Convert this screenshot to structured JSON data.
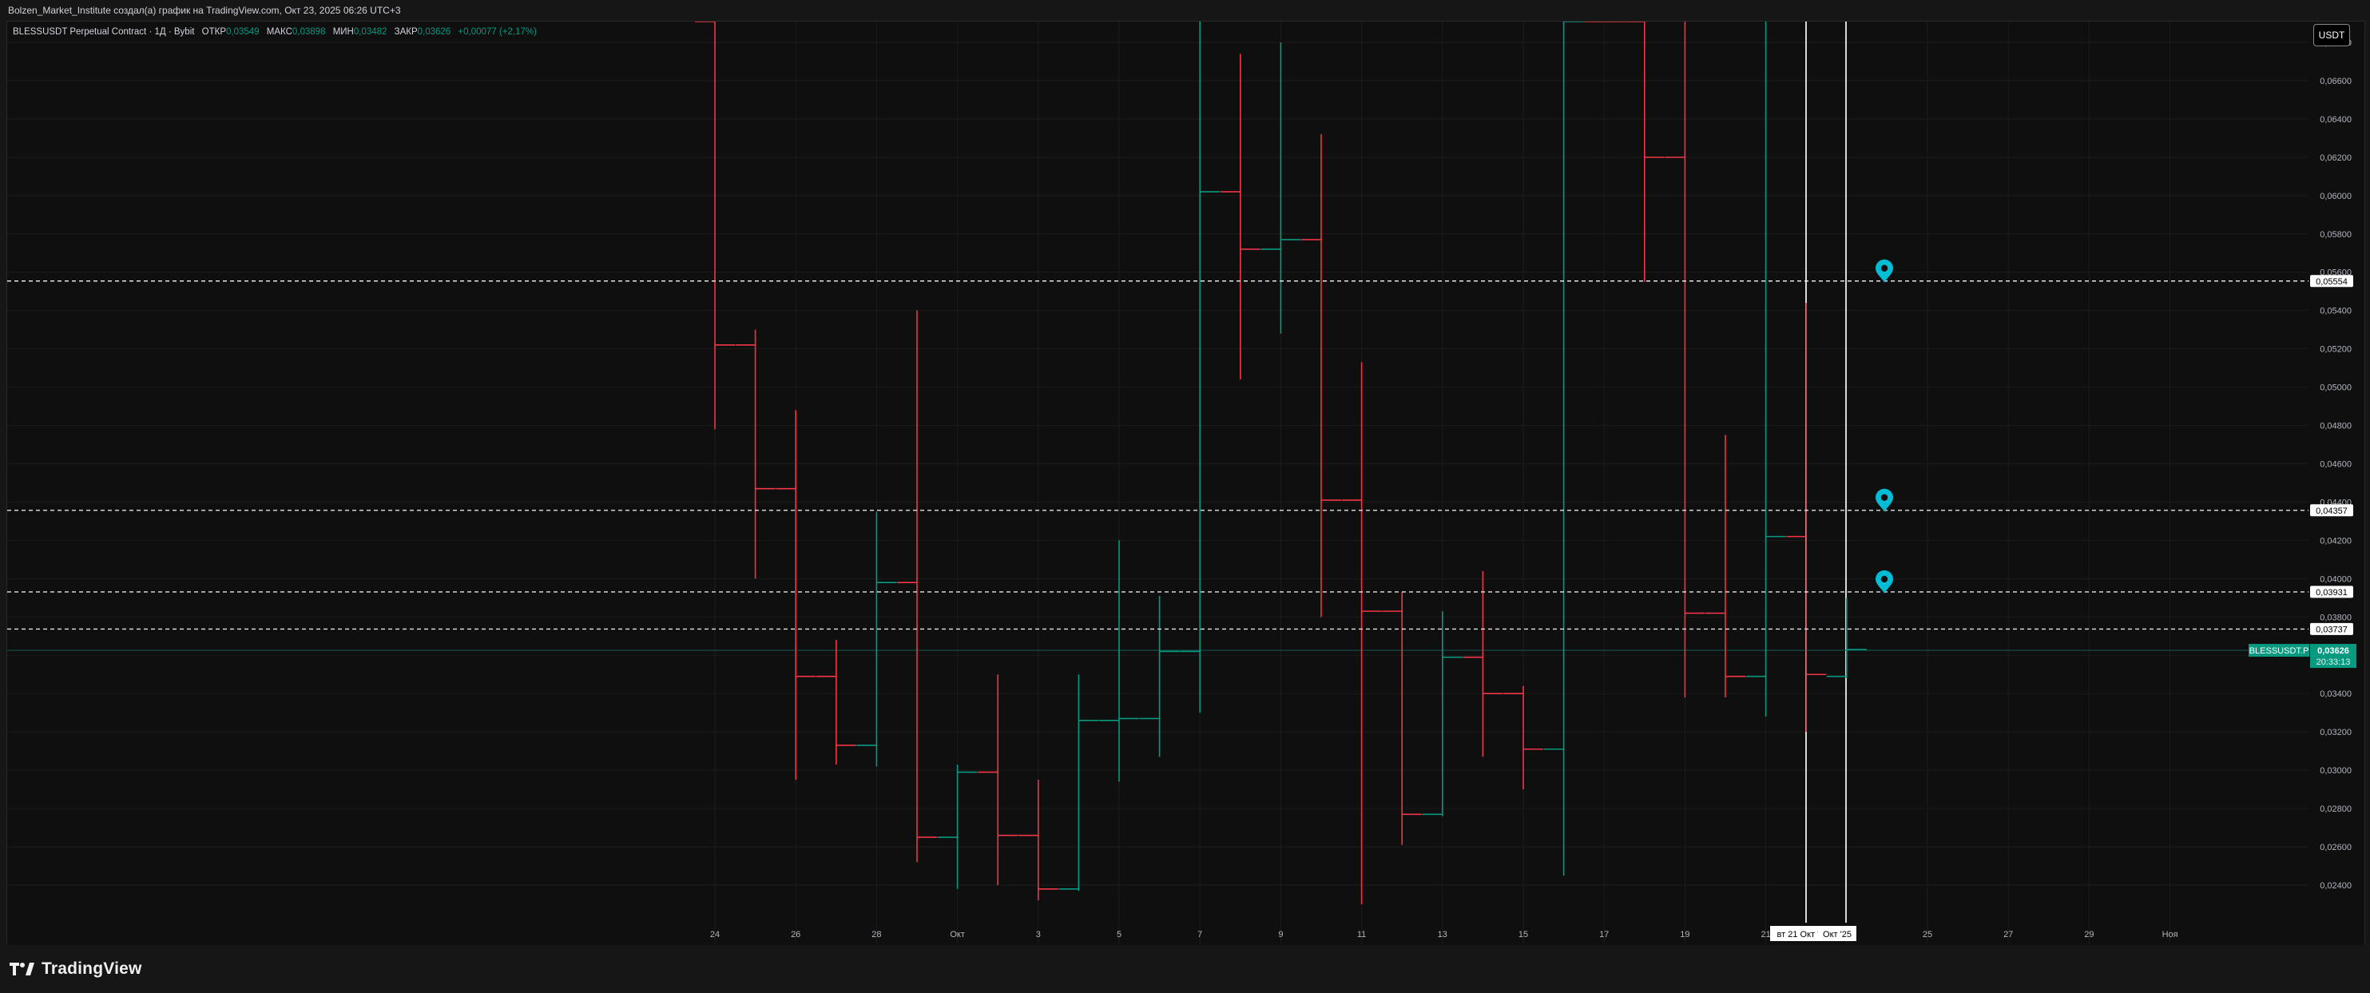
{
  "caption": "Bolzen_Market_Institute создал(а) график на TradingView.com, Окт 23, 2025 06:26 UTC+3",
  "legend": {
    "symbol": "BLESSUSDT Perpetual Contract · 1Д · Bybit",
    "open_label": "ОТКР",
    "open": "0,03549",
    "high_label": "МАКС",
    "high": "0,03898",
    "low_label": "МИН",
    "low": "0,03482",
    "close_label": "ЗАКР",
    "close": "0,03626",
    "change": "+0,00077 (+2,17%)"
  },
  "currency_button": "USDT",
  "logo_text": "TradingView",
  "colors": {
    "up": "#089981",
    "down": "#f23645",
    "marker": "#00bcd4",
    "background": "#0f0f0f",
    "grid": "#1c1c1c"
  },
  "chart_data": {
    "type": "ohlc",
    "x_tick_labels": [
      "24",
      "26",
      "28",
      "Окт",
      "3",
      "5",
      "7",
      "9",
      "11",
      "13",
      "15",
      "17",
      "19",
      "21",
      "23",
      "25",
      "27",
      "29",
      "Ноя"
    ],
    "y_tick_labels": [
      "0,06800",
      "0,06600",
      "0,06400",
      "0,06200",
      "0,06000",
      "0,05800",
      "0,05600",
      "0,05400",
      "0,05200",
      "0,05000",
      "0,04800",
      "0,04600",
      "0,04400",
      "0,04200",
      "0,04000",
      "0,03800",
      "0,03600",
      "0,03400",
      "0,03200",
      "0,03000",
      "0,02800",
      "0,02600",
      "0,02400"
    ],
    "ylim": [
      0.0227,
      0.0698
    ],
    "bars": [
      {
        "o": 0.0744,
        "h": 0.0745,
        "l": 0.0478,
        "c": 0.0522
      },
      {
        "o": 0.0522,
        "h": 0.053,
        "l": 0.04,
        "c": 0.0447
      },
      {
        "o": 0.0447,
        "h": 0.0488,
        "l": 0.0295,
        "c": 0.0349
      },
      {
        "o": 0.0349,
        "h": 0.0368,
        "l": 0.0303,
        "c": 0.0313
      },
      {
        "o": 0.0313,
        "h": 0.0435,
        "l": 0.0302,
        "c": 0.0398
      },
      {
        "o": 0.0398,
        "h": 0.054,
        "l": 0.0252,
        "c": 0.0265
      },
      {
        "o": 0.0265,
        "h": 0.0303,
        "l": 0.0238,
        "c": 0.0299
      },
      {
        "o": 0.0299,
        "h": 0.035,
        "l": 0.024,
        "c": 0.0266
      },
      {
        "o": 0.0266,
        "h": 0.0295,
        "l": 0.0232,
        "c": 0.0238
      },
      {
        "o": 0.0238,
        "h": 0.035,
        "l": 0.0237,
        "c": 0.0326
      },
      {
        "o": 0.0326,
        "h": 0.042,
        "l": 0.0294,
        "c": 0.0327
      },
      {
        "o": 0.0327,
        "h": 0.0391,
        "l": 0.0307,
        "c": 0.0362
      },
      {
        "o": 0.0362,
        "h": 0.072,
        "l": 0.033,
        "c": 0.0602
      },
      {
        "o": 0.0602,
        "h": 0.0674,
        "l": 0.0504,
        "c": 0.0572
      },
      {
        "o": 0.0572,
        "h": 0.068,
        "l": 0.0528,
        "c": 0.0577
      },
      {
        "o": 0.0577,
        "h": 0.0632,
        "l": 0.038,
        "c": 0.0441
      },
      {
        "o": 0.0441,
        "h": 0.0513,
        "l": 0.023,
        "c": 0.0383
      },
      {
        "o": 0.0383,
        "h": 0.0393,
        "l": 0.0261,
        "c": 0.0277
      },
      {
        "o": 0.0277,
        "h": 0.0383,
        "l": 0.0276,
        "c": 0.0359
      },
      {
        "o": 0.0359,
        "h": 0.0404,
        "l": 0.0307,
        "c": 0.034
      },
      {
        "o": 0.034,
        "h": 0.0344,
        "l": 0.029,
        "c": 0.0311
      },
      {
        "o": 0.0311,
        "h": 0.072,
        "l": 0.0245,
        "c": 0.072
      },
      {
        "o": 0.072,
        "h": 0.072,
        "l": 0.0695,
        "c": 0.071
      },
      {
        "o": 0.071,
        "h": 0.072,
        "l": 0.0555,
        "c": 0.062
      },
      {
        "o": 0.062,
        "h": 0.072,
        "l": 0.0338,
        "c": 0.0382
      },
      {
        "o": 0.0382,
        "h": 0.0475,
        "l": 0.0338,
        "c": 0.0349
      },
      {
        "o": 0.0349,
        "h": 0.072,
        "l": 0.0328,
        "c": 0.0422
      },
      {
        "o": 0.0422,
        "h": 0.0544,
        "l": 0.032,
        "c": 0.035
      },
      {
        "o": 0.0349,
        "h": 0.039,
        "l": 0.0348,
        "c": 0.0363
      }
    ],
    "horizontal_lines": [
      {
        "value": 0.05554,
        "label": "0,05554",
        "marker": true
      },
      {
        "value": 0.04357,
        "label": "0,04357",
        "marker": true
      },
      {
        "value": 0.03931,
        "label": "0,03931",
        "marker": true
      },
      {
        "value": 0.03737,
        "label": "0,03737",
        "marker": false
      }
    ],
    "current_price": {
      "symbol": "BLESSUSDT.P",
      "value": 0.03626,
      "label": "0,03626",
      "countdown": "20:33:13"
    },
    "vertical_markers": [
      {
        "label": "вт 21 Окт '25"
      },
      {
        "label": "Окт '25"
      }
    ]
  }
}
